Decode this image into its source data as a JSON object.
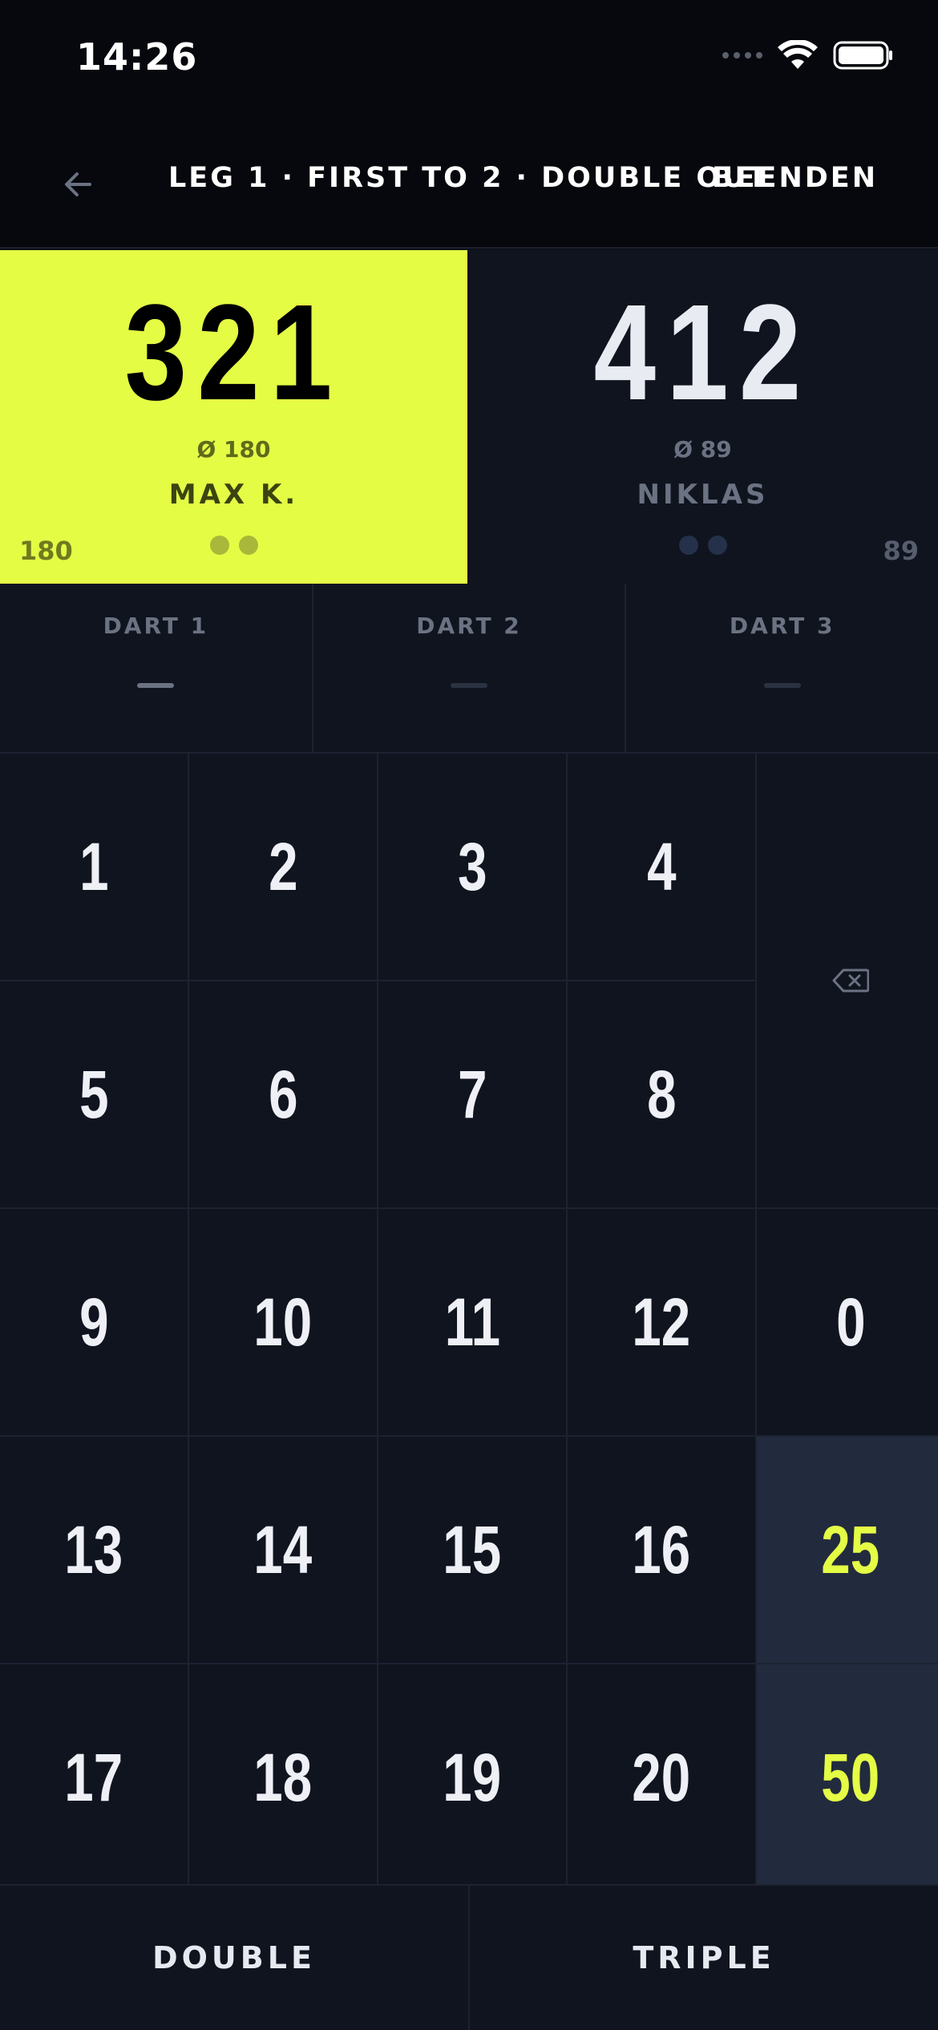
{
  "status": {
    "time": "14:26"
  },
  "nav": {
    "title": "LEG 1 · FIRST TO 2 · DOUBLE OUT",
    "end_label": "BEENDEN"
  },
  "players": [
    {
      "score": "321",
      "average": "Ø 180",
      "name": "MAX K.",
      "last_throw": "180",
      "legs_total": 2,
      "active": true
    },
    {
      "score": "412",
      "average": "Ø 89",
      "name": "NIKLAS",
      "last_throw": "89",
      "legs_total": 2,
      "active": false
    }
  ],
  "darts": [
    {
      "label": "DART 1",
      "value": "—"
    },
    {
      "label": "DART 2",
      "value": "—"
    },
    {
      "label": "DART 3",
      "value": "—"
    }
  ],
  "keypad": {
    "row1": [
      "1",
      "2",
      "3",
      "4"
    ],
    "row2": [
      "5",
      "6",
      "7",
      "8"
    ],
    "row3": [
      "9",
      "10",
      "11",
      "12",
      "0"
    ],
    "row4": [
      "13",
      "14",
      "15",
      "16",
      "25"
    ],
    "row5": [
      "17",
      "18",
      "19",
      "20",
      "50"
    ],
    "backspace_icon": "backspace-icon"
  },
  "modifiers": {
    "double": "DOUBLE",
    "triple": "TRIPLE"
  },
  "colors": {
    "accent": "#e5fc45",
    "background": "#0f141f",
    "bull_key": "#222b3d"
  }
}
